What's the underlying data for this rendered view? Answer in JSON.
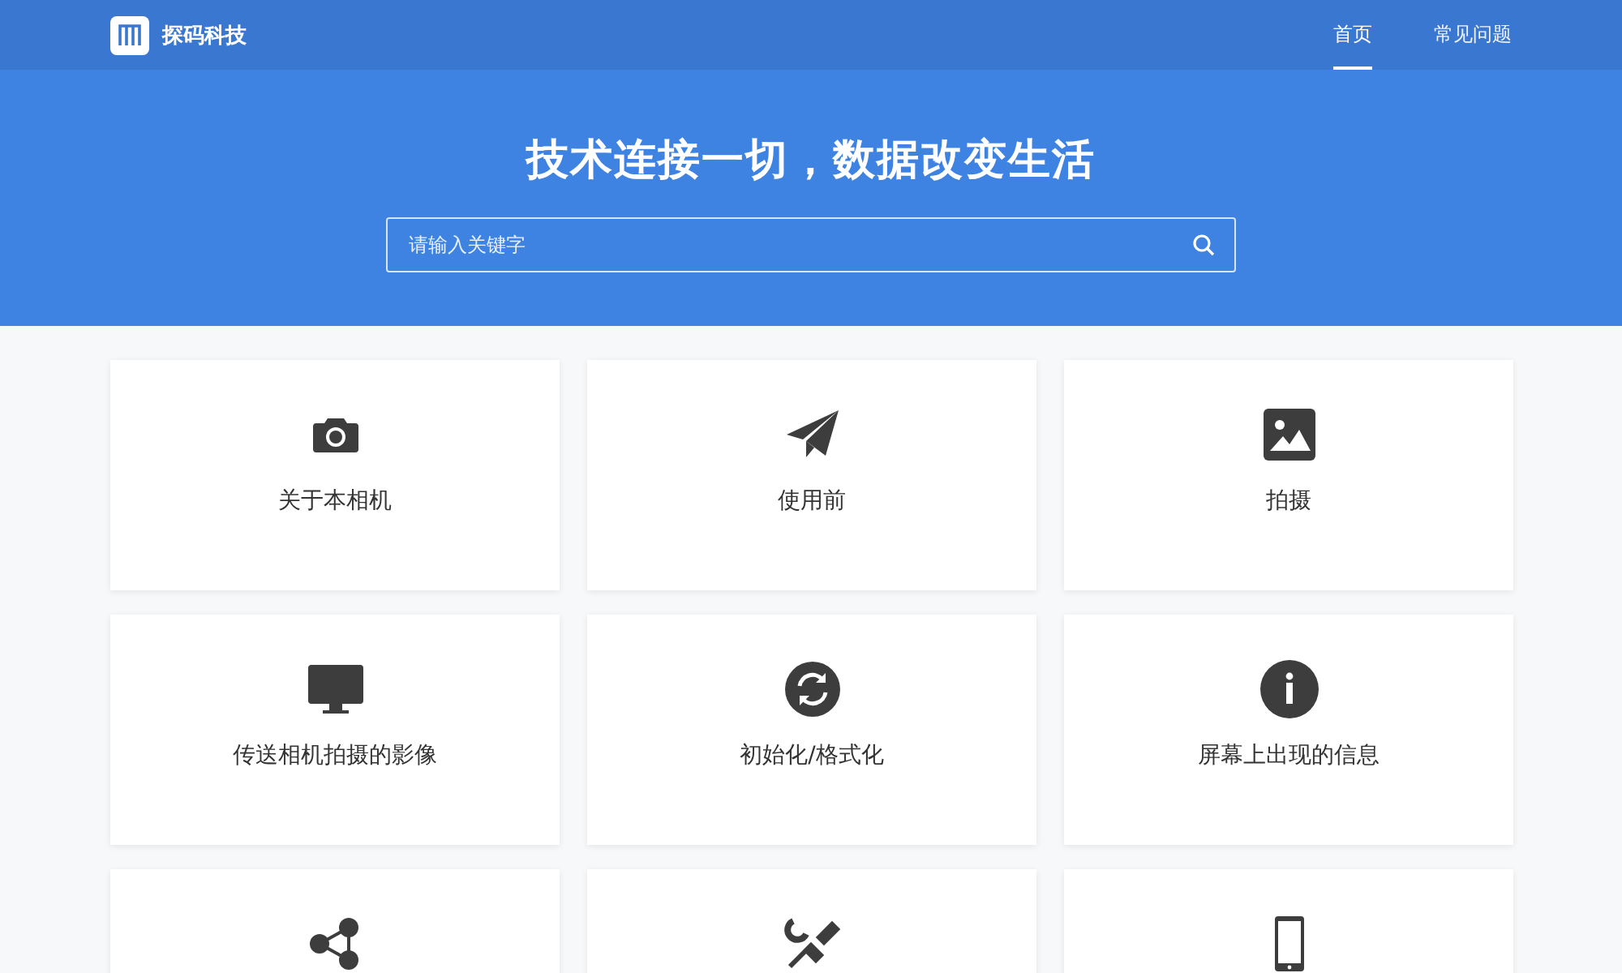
{
  "header": {
    "brand": "探码科技",
    "nav": [
      {
        "label": "首页",
        "selected": true
      },
      {
        "label": "常见问题",
        "selected": false
      }
    ]
  },
  "hero": {
    "title": "技术连接一切，数据改变生活",
    "search": {
      "placeholder": "请输入关键字"
    }
  },
  "cards": [
    {
      "kind": "camera",
      "label": "关于本相机"
    },
    {
      "kind": "plane",
      "label": "使用前"
    },
    {
      "kind": "image",
      "label": "拍摄"
    },
    {
      "kind": "monitor",
      "label": "传送相机拍摄的影像"
    },
    {
      "kind": "refresh",
      "label": "初始化/格式化"
    },
    {
      "kind": "info",
      "label": "屏幕上出现的信息"
    },
    {
      "kind": "share"
    },
    {
      "kind": "tools"
    },
    {
      "kind": "phone"
    }
  ]
}
